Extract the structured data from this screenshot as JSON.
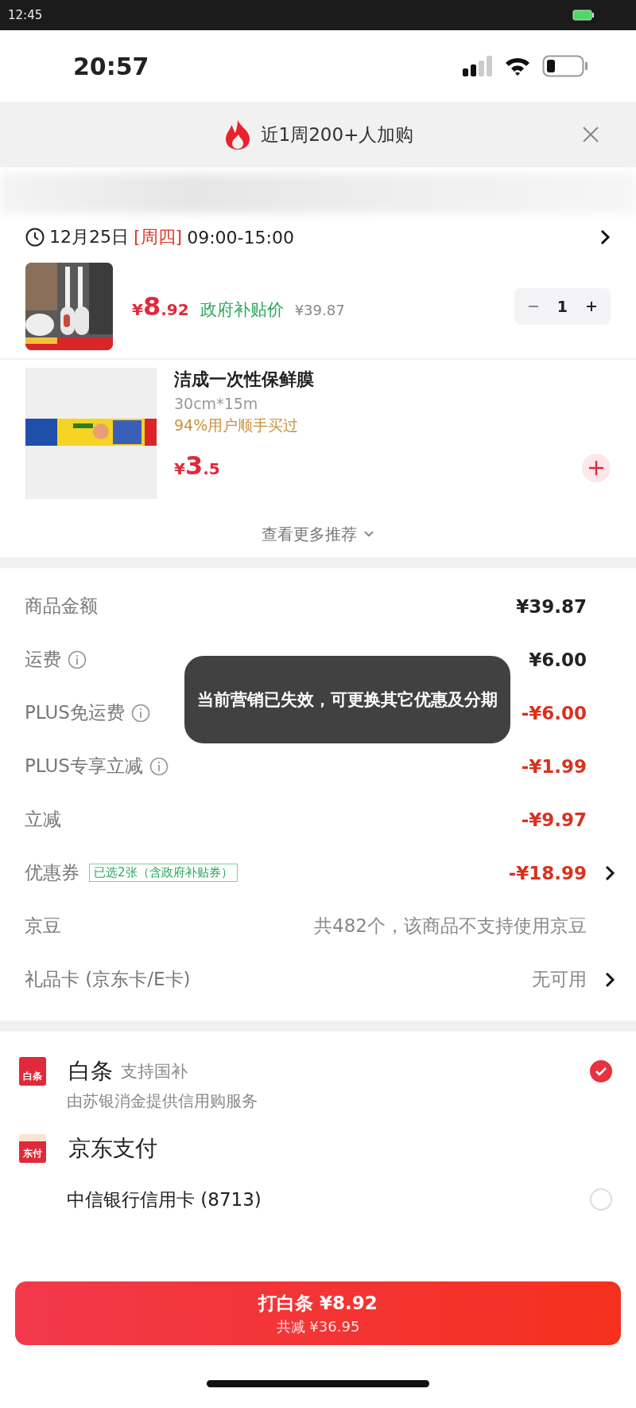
{
  "system_bar": {
    "time": "12:45"
  },
  "phone_status": {
    "time": "20:57"
  },
  "banner": {
    "text": "近1周200+人加购"
  },
  "delivery": {
    "date": "12月25日",
    "weekday": "[周四]",
    "time_range": "09:00-15:00"
  },
  "cart_item": {
    "price_symbol": "¥",
    "price_int": "8",
    "price_dec": ".92",
    "price_label": "政府补贴价",
    "original_price": "¥39.87",
    "quantity": "1"
  },
  "recommendation": {
    "title": "洁成一次性保鲜膜",
    "spec": "30cm*15m",
    "social_proof": "94%用户顺手买过",
    "price_symbol": "¥",
    "price_int": "3",
    "price_dec": ".5"
  },
  "more_link": "查看更多推荐",
  "summary": [
    {
      "label": "商品金额",
      "value": "¥39.87",
      "kind": "amount"
    },
    {
      "label": "运费",
      "value": "¥6.00",
      "kind": "amount",
      "info": true
    },
    {
      "label": "PLUS免运费",
      "value": "-¥6.00",
      "kind": "discount",
      "info": true
    },
    {
      "label": "PLUS专享立减",
      "value": "-¥1.99",
      "kind": "discount",
      "info": true
    },
    {
      "label": "立减",
      "value": "-¥9.97",
      "kind": "discount"
    },
    {
      "label": "优惠券",
      "tag": "已选2张（含政府补贴券）",
      "value": "-¥18.99",
      "kind": "discount",
      "chevron": true
    },
    {
      "label": "京豆",
      "value": "共482个，该商品不支持使用京豆",
      "kind": "note"
    },
    {
      "label": "礼品卡 (京东卡/E卡)",
      "value": "无可用",
      "kind": "note",
      "chevron": true
    }
  ],
  "toast": "当前营销已失效，可更换其它优惠及分期",
  "payments": [
    {
      "kind": "method",
      "logo_text": "白条",
      "name": "白条",
      "note": "支持国补",
      "description": "由苏银消金提供信用购服务",
      "selected": true
    },
    {
      "kind": "group",
      "logo_text": "东付",
      "name": "京东支付"
    },
    {
      "kind": "card",
      "name": "中信银行信用卡 (8713)",
      "selected": false
    }
  ],
  "pay_button": {
    "title": "打白条 ¥8.92",
    "subtitle": "共减 ¥36.95"
  }
}
